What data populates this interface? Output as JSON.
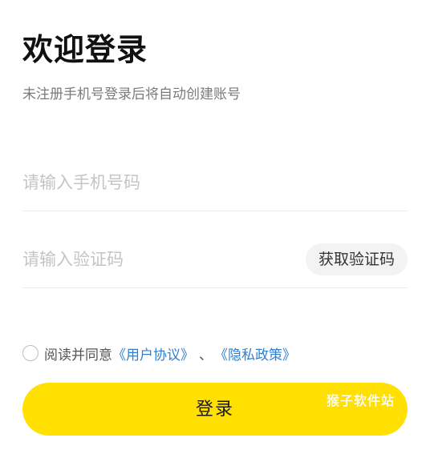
{
  "header": {
    "title": "欢迎登录",
    "subtitle": "未注册手机号登录后将自动创建账号"
  },
  "phone_field": {
    "value": "",
    "placeholder": "请输入手机号码"
  },
  "code_field": {
    "value": "",
    "placeholder": "请输入验证码",
    "get_code_label": "获取验证码"
  },
  "agreement": {
    "checked": false,
    "prefix": "阅读并同意",
    "user_agreement": "《用户协议》",
    "separator": "、",
    "privacy_policy": "《隐私政策》"
  },
  "login_button": {
    "label": "登录"
  },
  "watermark": "猴子软件站",
  "colors": {
    "accent": "#ffe000",
    "link": "#2f7fd1",
    "placeholder": "#c4c4c4",
    "divider": "#ebebeb"
  }
}
